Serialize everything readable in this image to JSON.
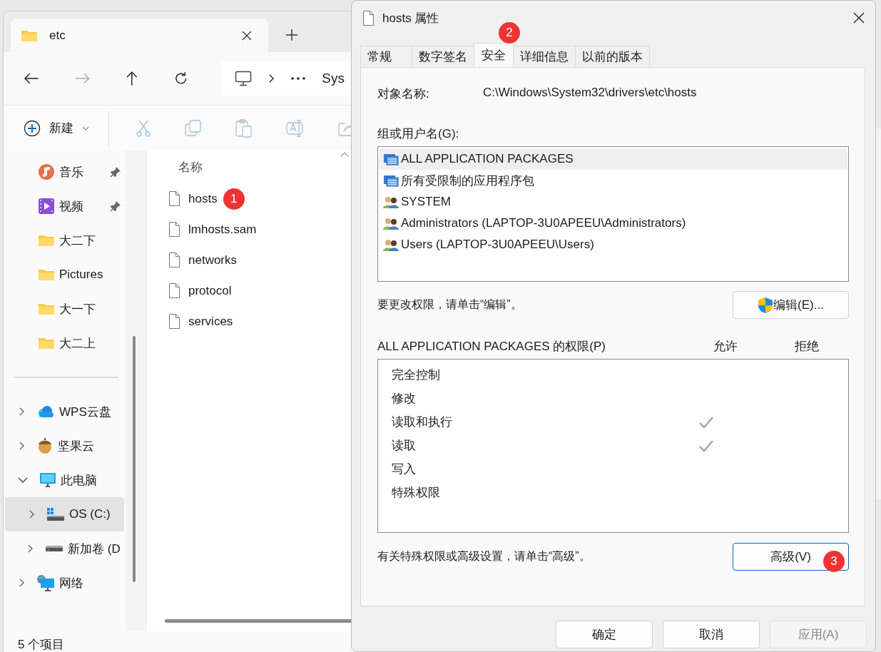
{
  "explorer": {
    "tab": {
      "title": "etc"
    },
    "address": {
      "crumb": "Sys"
    },
    "toolbar": {
      "new_label": "新建"
    },
    "quick_access": [
      {
        "label": "音乐",
        "kind": "music",
        "pinned": true
      },
      {
        "label": "视频",
        "kind": "video",
        "pinned": true
      },
      {
        "label": "大二下",
        "kind": "folder",
        "pinned": false
      },
      {
        "label": "Pictures",
        "kind": "folder",
        "pinned": false
      },
      {
        "label": "大一下",
        "kind": "folder",
        "pinned": false
      },
      {
        "label": "大二上",
        "kind": "folder",
        "pinned": false
      }
    ],
    "tree": [
      {
        "label": "WPS云盘",
        "kind": "cloud",
        "expanded": false,
        "selected": false
      },
      {
        "label": "坚果云",
        "kind": "nut",
        "expanded": false,
        "selected": false
      },
      {
        "label": "此电脑",
        "kind": "pc",
        "expanded": true,
        "selected": false,
        "children": [
          {
            "label": "OS (C:)",
            "kind": "system-drive",
            "expanded": false,
            "selected": true
          },
          {
            "label": "新加卷 (D",
            "kind": "drive",
            "expanded": false,
            "selected": false
          }
        ]
      },
      {
        "label": "网络",
        "kind": "network",
        "expanded": false,
        "selected": false
      }
    ],
    "file_list": {
      "column_header": "名称",
      "files": [
        {
          "name": "hosts",
          "badge": "1"
        },
        {
          "name": "lmhosts.sam"
        },
        {
          "name": "networks"
        },
        {
          "name": "protocol"
        },
        {
          "name": "services"
        }
      ]
    },
    "status_bar": "5 个项目"
  },
  "dialog": {
    "title": "hosts 属性",
    "tabs": [
      {
        "label": "常规",
        "selected": false
      },
      {
        "label": "数字签名",
        "selected": false
      },
      {
        "label": "安全",
        "selected": true,
        "badge": "2"
      },
      {
        "label": "详细信息",
        "selected": false
      },
      {
        "label": "以前的版本",
        "selected": false
      }
    ],
    "object_name": {
      "label": "对象名称:",
      "value": "C:\\Windows\\System32\\drivers\\etc\\hosts"
    },
    "groups_label": "组或用户名(G):",
    "groups": [
      {
        "name": "ALL APPLICATION PACKAGES",
        "kind": "package",
        "selected": true
      },
      {
        "name": "所有受限制的应用程序包",
        "kind": "package",
        "selected": false
      },
      {
        "name": "SYSTEM",
        "kind": "users",
        "selected": false
      },
      {
        "name": "Administrators (LAPTOP-3U0APEEU\\Administrators)",
        "kind": "users",
        "selected": false
      },
      {
        "name": "Users (LAPTOP-3U0APEEU\\Users)",
        "kind": "users",
        "selected": false
      }
    ],
    "edit_hint": "要更改权限，请单击“编辑”。",
    "edit_button": "编辑(E)...",
    "permissions_label": "ALL APPLICATION PACKAGES 的权限(P)",
    "allow_header": "允许",
    "deny_header": "拒绝",
    "permissions": [
      {
        "name": "完全控制",
        "allow": false,
        "deny": false
      },
      {
        "name": "修改",
        "allow": false,
        "deny": false
      },
      {
        "name": "读取和执行",
        "allow": true,
        "deny": false
      },
      {
        "name": "读取",
        "allow": true,
        "deny": false
      },
      {
        "name": "写入",
        "allow": false,
        "deny": false
      },
      {
        "name": "特殊权限",
        "allow": false,
        "deny": false
      }
    ],
    "advanced_hint": "有关特殊权限或高级设置，请单击“高级”。",
    "advanced_button": {
      "label": "高级(V)",
      "badge": "3"
    },
    "buttons": [
      {
        "label": "确定",
        "disabled": false
      },
      {
        "label": "取消",
        "disabled": false
      },
      {
        "label": "应用(A)",
        "disabled": true
      }
    ]
  }
}
